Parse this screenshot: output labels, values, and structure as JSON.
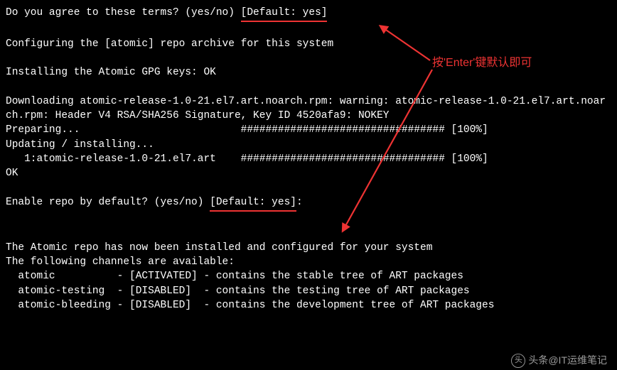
{
  "term": {
    "q_agree": "Do you agree to these terms? (yes/no) ",
    "default1": "[Default: yes]",
    "blank": " ",
    "config": "Configuring the [atomic] repo archive for this system",
    "install_gpg": "Installing the Atomic GPG keys: OK",
    "download": "Downloading atomic-release-1.0-21.el7.art.noarch.rpm: warning: atomic-release-1.0-21.el7.art.noarch.rpm: Header V4 RSA/SHA256 Signature, Key ID 4520afa9: NOKEY",
    "preparing": "Preparing...                          ################################# [100%]",
    "updating": "Updating / installing...",
    "pkgline": "   1:atomic-release-1.0-21.el7.art    ################################# [100%]",
    "ok": "OK",
    "q_enable": "Enable repo by default? (yes/no) ",
    "default2": "[Default: yes]",
    "colon": ":",
    "installed": "The Atomic repo has now been installed and configured for your system",
    "chan_hdr": "The following channels are available:",
    "chan1": "  atomic          - [ACTIVATED] - contains the stable tree of ART packages",
    "chan2": "  atomic-testing  - [DISABLED]  - contains the testing tree of ART packages",
    "chan3": "  atomic-bleeding - [DISABLED]  - contains the development tree of ART packages"
  },
  "channels": [
    {
      "name": "atomic",
      "state": "ACTIVATED",
      "desc": "contains the stable tree of ART packages"
    },
    {
      "name": "atomic-testing",
      "state": "DISABLED",
      "desc": "contains the testing tree of ART packages"
    },
    {
      "name": "atomic-bleeding",
      "state": "DISABLED",
      "desc": "contains the development tree of ART packages"
    }
  ],
  "annotation": {
    "label": "按'Enter'键默认即可",
    "color": "#e33"
  },
  "watermark": {
    "prefix": "头条",
    "text": "@IT运维笔记"
  }
}
